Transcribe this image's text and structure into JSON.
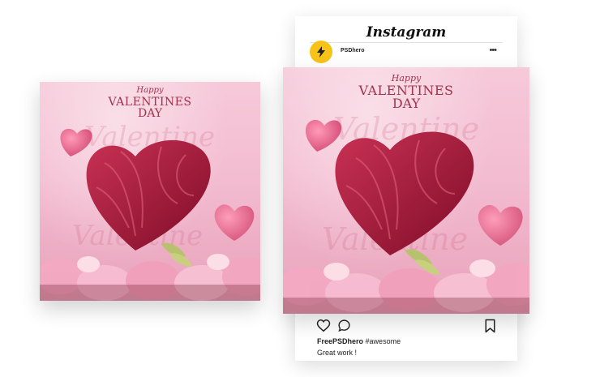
{
  "flyer": {
    "happy": "Happy",
    "line1": "VALENTINES",
    "line2": "DAY",
    "ghost_text": "Valentine"
  },
  "instagram": {
    "logo": "Instagram",
    "username": "PSDhero",
    "more": "•••",
    "caption_user": "FreePSDhero",
    "caption_tag": "#awesome",
    "comment": "Great work !"
  },
  "icons": [
    "heart-icon",
    "comment-icon",
    "bookmark-icon",
    "more-icon",
    "lightning-bolt-icon"
  ],
  "colors": {
    "pink_bg": "#f3bcd0",
    "heart_red": "#a8183a",
    "title": "#a0324c",
    "avatar": "#f7c318"
  }
}
